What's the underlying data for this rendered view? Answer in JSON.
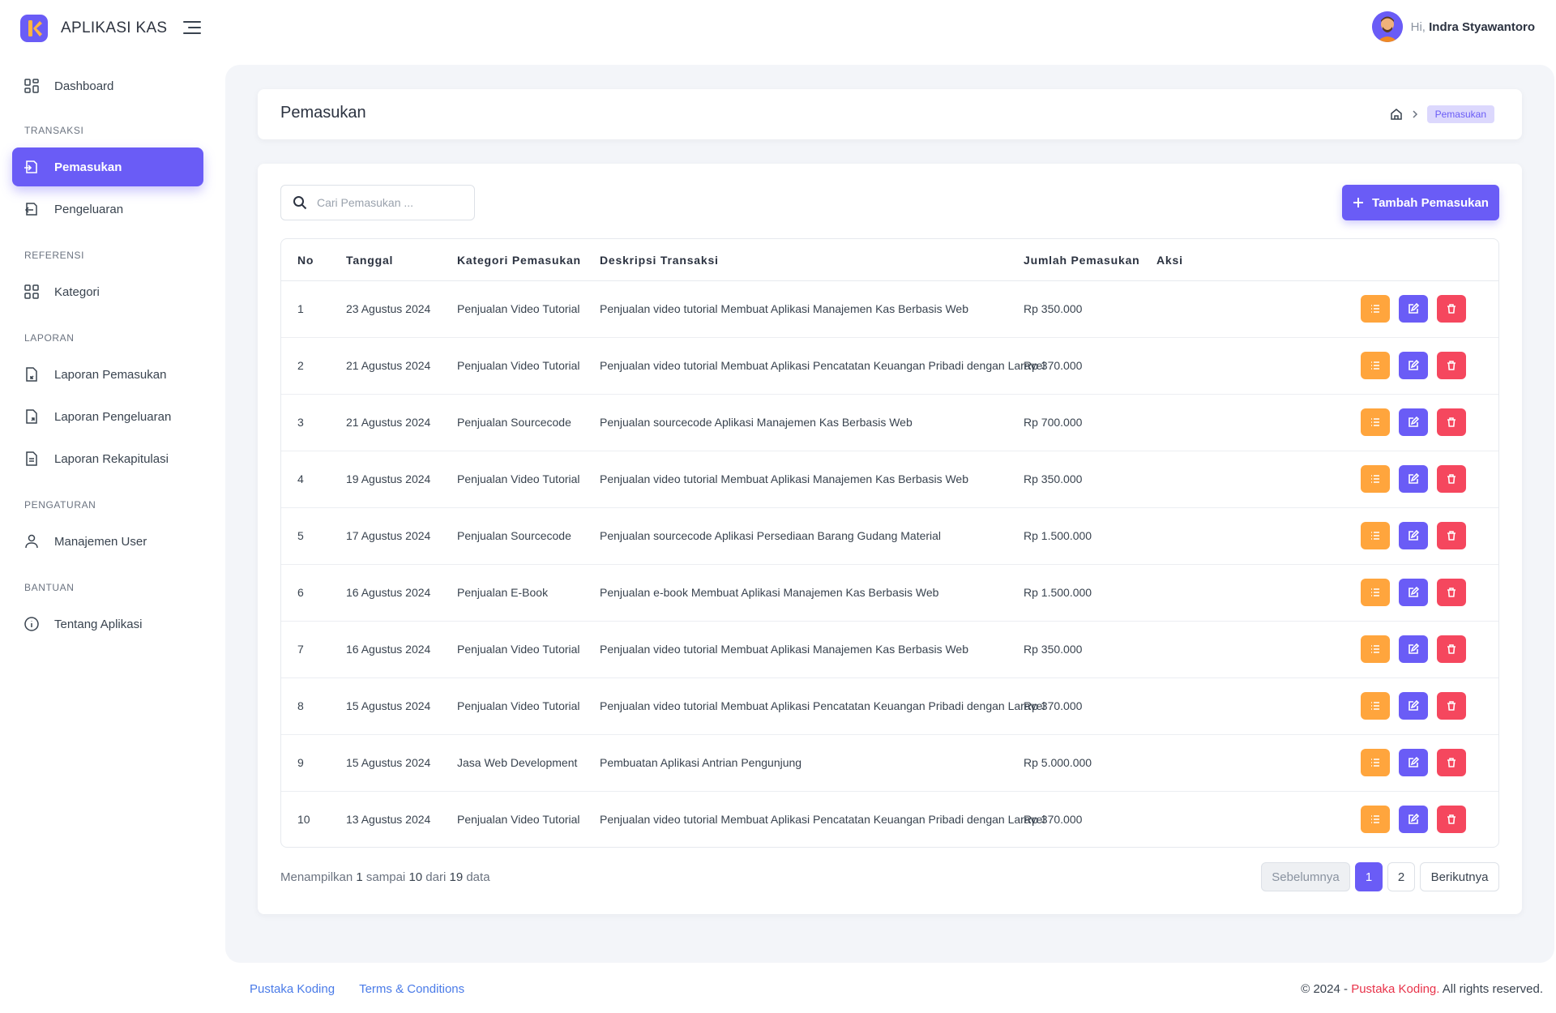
{
  "app": {
    "name": "APLIKASI KAS"
  },
  "user": {
    "greeting": "Hi,",
    "name": "Indra Styawantoro"
  },
  "sidebar": {
    "dashboard": "Dashboard",
    "sections": {
      "transaksi": "TRANSAKSI",
      "referensi": "REFERENSI",
      "laporan": "LAPORAN",
      "pengaturan": "PENGATURAN",
      "bantuan": "BANTUAN"
    },
    "items": {
      "pemasukan": "Pemasukan",
      "pengeluaran": "Pengeluaran",
      "kategori": "Kategori",
      "laporan_pemasukan": "Laporan Pemasukan",
      "laporan_pengeluaran": "Laporan Pengeluaran",
      "laporan_rekapitulasi": "Laporan Rekapitulasi",
      "manajemen_user": "Manajemen User",
      "tentang_aplikasi": "Tentang Aplikasi"
    }
  },
  "page": {
    "title": "Pemasukan",
    "breadcrumb_current": "Pemasukan"
  },
  "search": {
    "placeholder": "Cari Pemasukan ...",
    "value": ""
  },
  "add_button": {
    "label": "Tambah Pemasukan"
  },
  "table": {
    "headers": {
      "no": "No",
      "tanggal": "Tanggal",
      "kategori": "Kategori Pemasukan",
      "deskripsi": "Deskripsi Transaksi",
      "jumlah": "Jumlah Pemasukan",
      "aksi": "Aksi"
    },
    "rows": [
      {
        "no": "1",
        "tanggal": "23 Agustus 2024",
        "kategori": "Penjualan Video Tutorial",
        "deskripsi": "Penjualan video tutorial Membuat Aplikasi Manajemen Kas Berbasis Web",
        "jumlah": "Rp 350.000"
      },
      {
        "no": "2",
        "tanggal": "21 Agustus 2024",
        "kategori": "Penjualan Video Tutorial",
        "deskripsi": "Penjualan video tutorial Membuat Aplikasi Pencatatan Keuangan Pribadi dengan Laravel",
        "jumlah": "Rp 370.000"
      },
      {
        "no": "3",
        "tanggal": "21 Agustus 2024",
        "kategori": "Penjualan Sourcecode",
        "deskripsi": "Penjualan sourcecode Aplikasi Manajemen Kas Berbasis Web",
        "jumlah": "Rp 700.000"
      },
      {
        "no": "4",
        "tanggal": "19 Agustus 2024",
        "kategori": "Penjualan Video Tutorial",
        "deskripsi": "Penjualan video tutorial Membuat Aplikasi Manajemen Kas Berbasis Web",
        "jumlah": "Rp 350.000"
      },
      {
        "no": "5",
        "tanggal": "17 Agustus 2024",
        "kategori": "Penjualan Sourcecode",
        "deskripsi": "Penjualan sourcecode Aplikasi Persediaan Barang Gudang Material",
        "jumlah": "Rp 1.500.000"
      },
      {
        "no": "6",
        "tanggal": "16 Agustus 2024",
        "kategori": "Penjualan E-Book",
        "deskripsi": "Penjualan e-book Membuat Aplikasi Manajemen Kas Berbasis Web",
        "jumlah": "Rp 1.500.000"
      },
      {
        "no": "7",
        "tanggal": "16 Agustus 2024",
        "kategori": "Penjualan Video Tutorial",
        "deskripsi": "Penjualan video tutorial Membuat Aplikasi Manajemen Kas Berbasis Web",
        "jumlah": "Rp 350.000"
      },
      {
        "no": "8",
        "tanggal": "15 Agustus 2024",
        "kategori": "Penjualan Video Tutorial",
        "deskripsi": "Penjualan video tutorial Membuat Aplikasi Pencatatan Keuangan Pribadi dengan Laravel",
        "jumlah": "Rp 370.000"
      },
      {
        "no": "9",
        "tanggal": "15 Agustus 2024",
        "kategori": "Jasa Web Development",
        "deskripsi": "Pembuatan Aplikasi Antrian Pengunjung",
        "jumlah": "Rp 5.000.000"
      },
      {
        "no": "10",
        "tanggal": "13 Agustus 2024",
        "kategori": "Penjualan Video Tutorial",
        "deskripsi": "Penjualan video tutorial Membuat Aplikasi Pencatatan Keuangan Pribadi dengan Laravel",
        "jumlah": "Rp 370.000"
      }
    ]
  },
  "summary": {
    "prefix": "Menampilkan",
    "from": "1",
    "mid1": "sampai",
    "to": "10",
    "mid2": "dari",
    "total": "19",
    "suffix": "data"
  },
  "pagination": {
    "prev": "Sebelumnya",
    "pages": [
      "1",
      "2"
    ],
    "current": "1",
    "next": "Berikutnya"
  },
  "footer": {
    "link1": "Pustaka Koding",
    "link2": "Terms & Conditions",
    "copy_prefix": "© 2024 -",
    "copy_brand": "Pustaka Koding.",
    "copy_suffix": "All rights reserved."
  },
  "colors": {
    "accent": "#6a5cf6",
    "detail": "#ffa53d",
    "delete": "#f5475e",
    "link": "#4a7be8"
  }
}
